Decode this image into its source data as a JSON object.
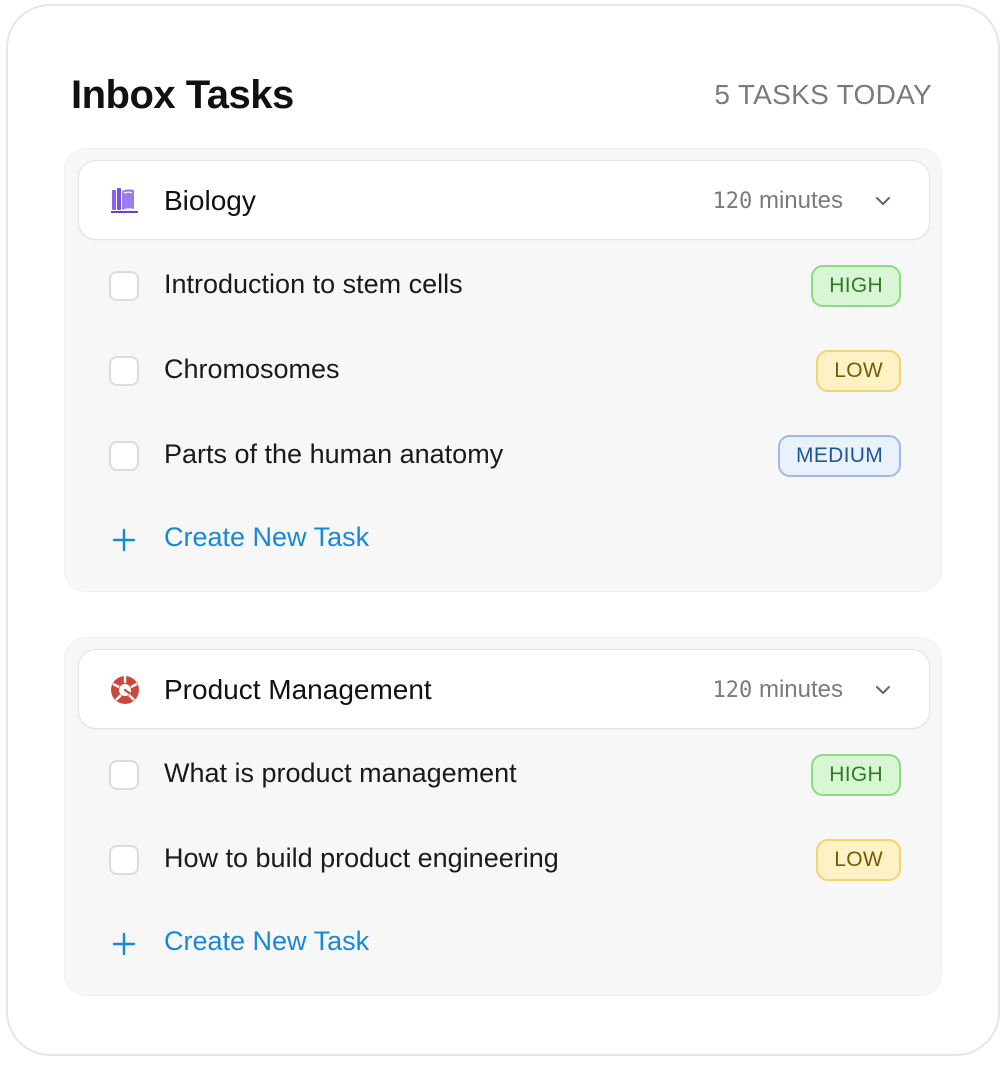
{
  "header": {
    "title": "Inbox Tasks",
    "count": "5 TASKS TODAY"
  },
  "groups": [
    {
      "name": "Biology",
      "icon": "book-icon",
      "icon_color": "#7b4fe0",
      "minutes_value": "120",
      "minutes_unit": "minutes",
      "tasks": [
        {
          "label": "Introduction to stem cells",
          "priority": "HIGH"
        },
        {
          "label": "Chromosomes",
          "priority": "LOW"
        },
        {
          "label": "Parts of the human anatomy",
          "priority": "MEDIUM"
        }
      ],
      "create_label": "Create New Task"
    },
    {
      "name": "Product Management",
      "icon": "gauge-icon",
      "icon_color": "#c9493f",
      "minutes_value": "120",
      "minutes_unit": "minutes",
      "tasks": [
        {
          "label": "What is product management",
          "priority": "HIGH"
        },
        {
          "label": "How to build product engineering",
          "priority": "LOW"
        }
      ],
      "create_label": "Create New Task"
    }
  ],
  "colors": {
    "accent": "#1788d9",
    "high": "#2f7d23",
    "low": "#7a5a00",
    "medium": "#1f5695"
  }
}
